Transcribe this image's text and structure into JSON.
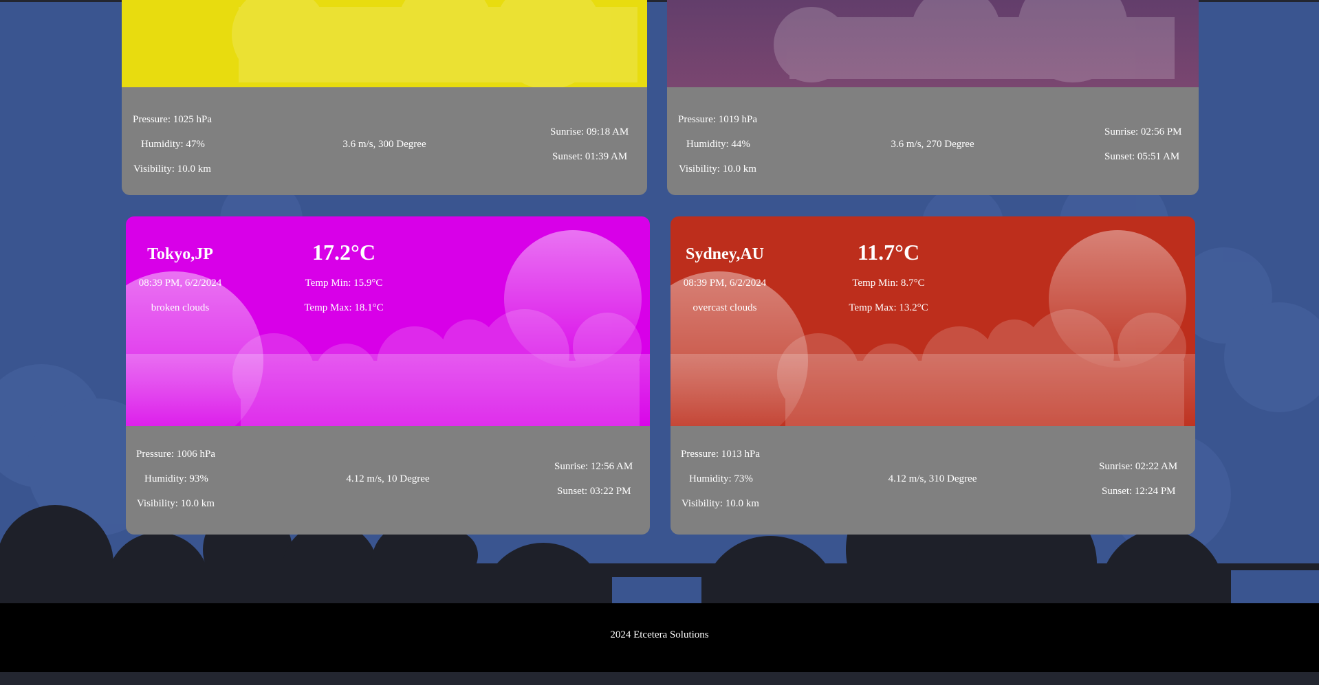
{
  "colors": {
    "page_bg": "#3a5590",
    "dark_cloud": "#1e2029",
    "details_bg": "#808080",
    "footer_bg": "#000000"
  },
  "cards": [
    {
      "color": "#e8dc0f",
      "details": {
        "pressure": "Pressure: 1025 hPa",
        "humidity": "Humidity: 47%",
        "visibility": "Visibility: 10.0 km",
        "wind": "3.6 m/s, 300 Degree",
        "sunrise": "Sunrise: 09:18 AM",
        "sunset": "Sunset: 01:39 AM"
      }
    },
    {
      "color": "#77456e",
      "details": {
        "pressure": "Pressure: 1019 hPa",
        "humidity": "Humidity: 44%",
        "visibility": "Visibility: 10.0 km",
        "wind": "3.6 m/s, 270 Degree",
        "sunrise": "Sunrise: 02:56 PM",
        "sunset": "Sunset: 05:51 AM"
      }
    },
    {
      "color": "#d800e8",
      "city": "Tokyo,JP",
      "datetime": "08:39 PM, 6/2/2024",
      "description": "broken clouds",
      "temp": "17.2°C",
      "temp_min": "Temp Min: 15.9°C",
      "temp_max": "Temp Max: 18.1°C",
      "details": {
        "pressure": "Pressure: 1006 hPa",
        "humidity": "Humidity: 93%",
        "visibility": "Visibility: 10.0 km",
        "wind": "4.12 m/s, 10 Degree",
        "sunrise": "Sunrise: 12:56 AM",
        "sunset": "Sunset: 03:22 PM"
      }
    },
    {
      "color": "#bd2e1c",
      "city": "Sydney,AU",
      "datetime": "08:39 PM, 6/2/2024",
      "description": "overcast clouds",
      "temp": "11.7°C",
      "temp_min": "Temp Min: 8.7°C",
      "temp_max": "Temp Max: 13.2°C",
      "details": {
        "pressure": "Pressure: 1013 hPa",
        "humidity": "Humidity: 73%",
        "visibility": "Visibility: 10.0 km",
        "wind": "4.12 m/s, 310 Degree",
        "sunrise": "Sunrise: 02:22 AM",
        "sunset": "Sunset: 12:24 PM"
      }
    }
  ],
  "footer": {
    "text": "2024 Etcetera Solutions"
  }
}
